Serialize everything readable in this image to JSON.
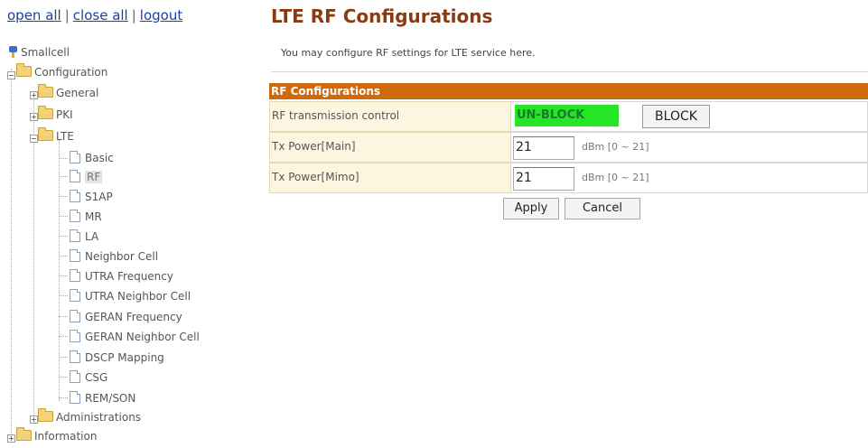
{
  "top_links": {
    "open_all": "open all",
    "close_all": "close all",
    "logout": "logout",
    "separator": "|"
  },
  "tree": {
    "root": "Smallcell",
    "configuration": "Configuration",
    "general": "General",
    "pki": "PKI",
    "lte": "LTE",
    "lte_items": [
      "Basic",
      "RF",
      "S1AP",
      "MR",
      "LA",
      "Neighbor Cell",
      "UTRA Frequency",
      "UTRA Neighbor Cell",
      "GERAN Frequency",
      "GERAN Neighbor Cell",
      "DSCP Mapping",
      "CSG",
      "REM/SON"
    ],
    "selected_item": "RF",
    "administrations": "Administrations",
    "information": "Information",
    "expander_plus": "+",
    "expander_minus": "−"
  },
  "main": {
    "title": "LTE RF Configurations",
    "description": "You may configure RF settings for LTE service here.",
    "section_title": "RF Configurations",
    "rows": {
      "rf_control": {
        "label": "RF transmission control",
        "status": "UN-BLOCK",
        "button": "BLOCK"
      },
      "tx_main": {
        "label": "Tx Power[Main]",
        "value": "21",
        "unit": "dBm [0 ~ 21]"
      },
      "tx_mimo": {
        "label": "Tx Power[Mimo]",
        "value": "21",
        "unit": "dBm [0 ~ 21]"
      }
    },
    "apply": "Apply",
    "cancel": "Cancel"
  },
  "colors": {
    "title": "#8a3a13",
    "section_header": "#cf6a0c",
    "label_cell": "#fcf6e1",
    "status_active": "#26e526",
    "link": "#1b3fa6"
  },
  "icons": {
    "root": "smallcell-icon",
    "folder": "folder-icon",
    "page": "page-icon"
  }
}
